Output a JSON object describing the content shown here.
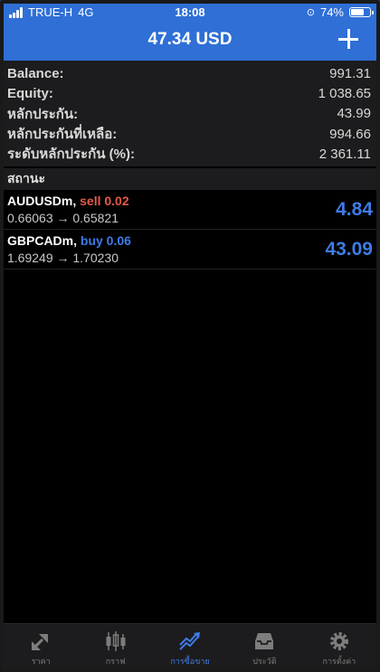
{
  "status_bar": {
    "carrier": "TRUE-H",
    "network": "4G",
    "time": "18:08",
    "battery": "74%",
    "battery_level": 0.74
  },
  "header": {
    "title": "47.34 USD"
  },
  "summary": [
    {
      "label": "Balance:",
      "value": "991.31"
    },
    {
      "label": "Equity:",
      "value": "1 038.65"
    },
    {
      "label": "หลักประกัน:",
      "value": "43.99"
    },
    {
      "label": "หลักประกันที่เหลือ:",
      "value": "994.66"
    },
    {
      "label": "ระดับหลักประกัน (%):",
      "value": "2 361.11"
    }
  ],
  "section_title": "สถานะ",
  "positions": [
    {
      "symbol": "AUDUSDm,",
      "side": "sell 0.02",
      "prices": "0.66063 → 0.65821",
      "profit": "4.84"
    },
    {
      "symbol": "GBPCADm,",
      "side": "buy 0.06",
      "prices": "1.69249 → 1.70230",
      "profit": "43.09"
    }
  ],
  "tabs": [
    {
      "label": "ราคา",
      "icon": "quotes-icon"
    },
    {
      "label": "กราฟ",
      "icon": "chart-icon"
    },
    {
      "label": "การซื้อขาย",
      "icon": "trade-icon",
      "active": true
    },
    {
      "label": "ประวัติ",
      "icon": "history-icon"
    },
    {
      "label": "การตั้งค่า",
      "icon": "settings-icon"
    }
  ],
  "colors": {
    "header": "#2f6fd6",
    "sell": "#e25b4b",
    "buy": "#3e7ce6",
    "profit": "#3e7ce6"
  }
}
